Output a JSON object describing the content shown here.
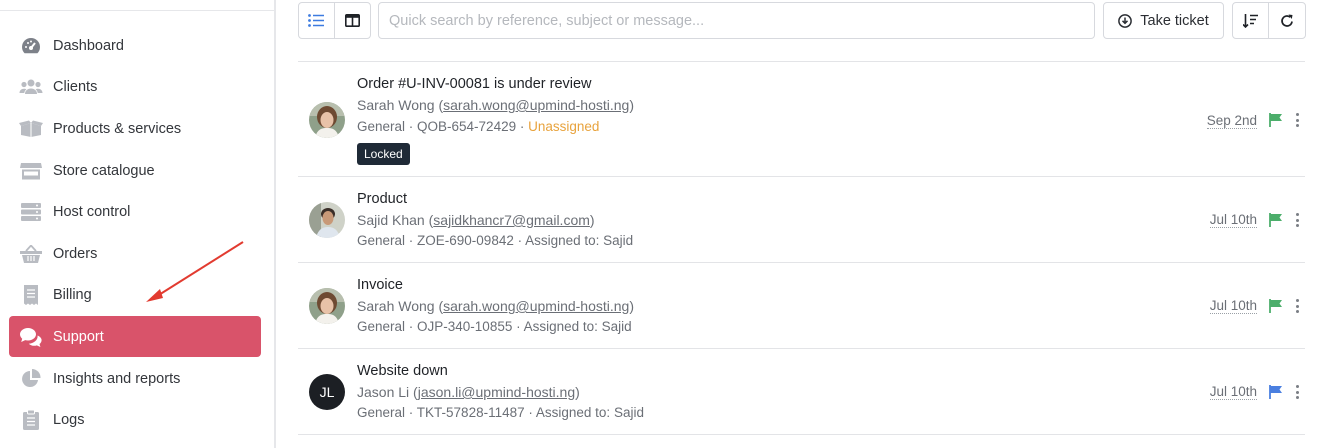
{
  "sidebar": {
    "items": [
      {
        "label": "Dashboard",
        "icon": "dashboard-icon"
      },
      {
        "label": "Clients",
        "icon": "users-icon"
      },
      {
        "label": "Products & services",
        "icon": "box-icon"
      },
      {
        "label": "Store catalogue",
        "icon": "store-icon"
      },
      {
        "label": "Host control",
        "icon": "server-icon"
      },
      {
        "label": "Orders",
        "icon": "basket-icon"
      },
      {
        "label": "Billing",
        "icon": "receipt-icon"
      },
      {
        "label": "Support",
        "icon": "chat-icon",
        "active": true
      },
      {
        "label": "Insights and reports",
        "icon": "pie-chart-icon"
      },
      {
        "label": "Logs",
        "icon": "clipboard-icon"
      }
    ],
    "active_color": "#d9536a"
  },
  "toolbar": {
    "search_placeholder": "Quick search by reference, subject or message...",
    "take_ticket_label": "Take ticket"
  },
  "tickets": [
    {
      "subject": "Order #U-INV-00081 is under review",
      "name": "Sarah Wong",
      "email": "sarah.wong@upmind-hosti.ng",
      "category": "General",
      "reference": "QOB-654-72429",
      "assignment": "Unassigned",
      "locked_label": "Locked",
      "date": "Sep 2nd",
      "flag_color": "#4cae6b"
    },
    {
      "subject": "Product",
      "name": "Sajid Khan",
      "email": "sajidkhancr7@gmail.com",
      "category": "General",
      "reference": "ZOE-690-09842",
      "assignment": "Assigned to: Sajid",
      "date": "Jul 10th",
      "flag_color": "#4cae6b"
    },
    {
      "subject": "Invoice",
      "name": "Sarah Wong",
      "email": "sarah.wong@upmind-hosti.ng",
      "category": "General",
      "reference": "OJP-340-10855",
      "assignment": "Assigned to: Sajid",
      "date": "Jul 10th",
      "flag_color": "#4cae6b"
    },
    {
      "subject": "Website down",
      "name": "Jason Li",
      "email": "jason.li@upmind-hosti.ng",
      "initials": "JL",
      "category": "General",
      "reference": "TKT-57828-11487",
      "assignment": "Assigned to: Sajid",
      "date": "Jul 10th",
      "flag_color": "#4a7fe0"
    }
  ]
}
